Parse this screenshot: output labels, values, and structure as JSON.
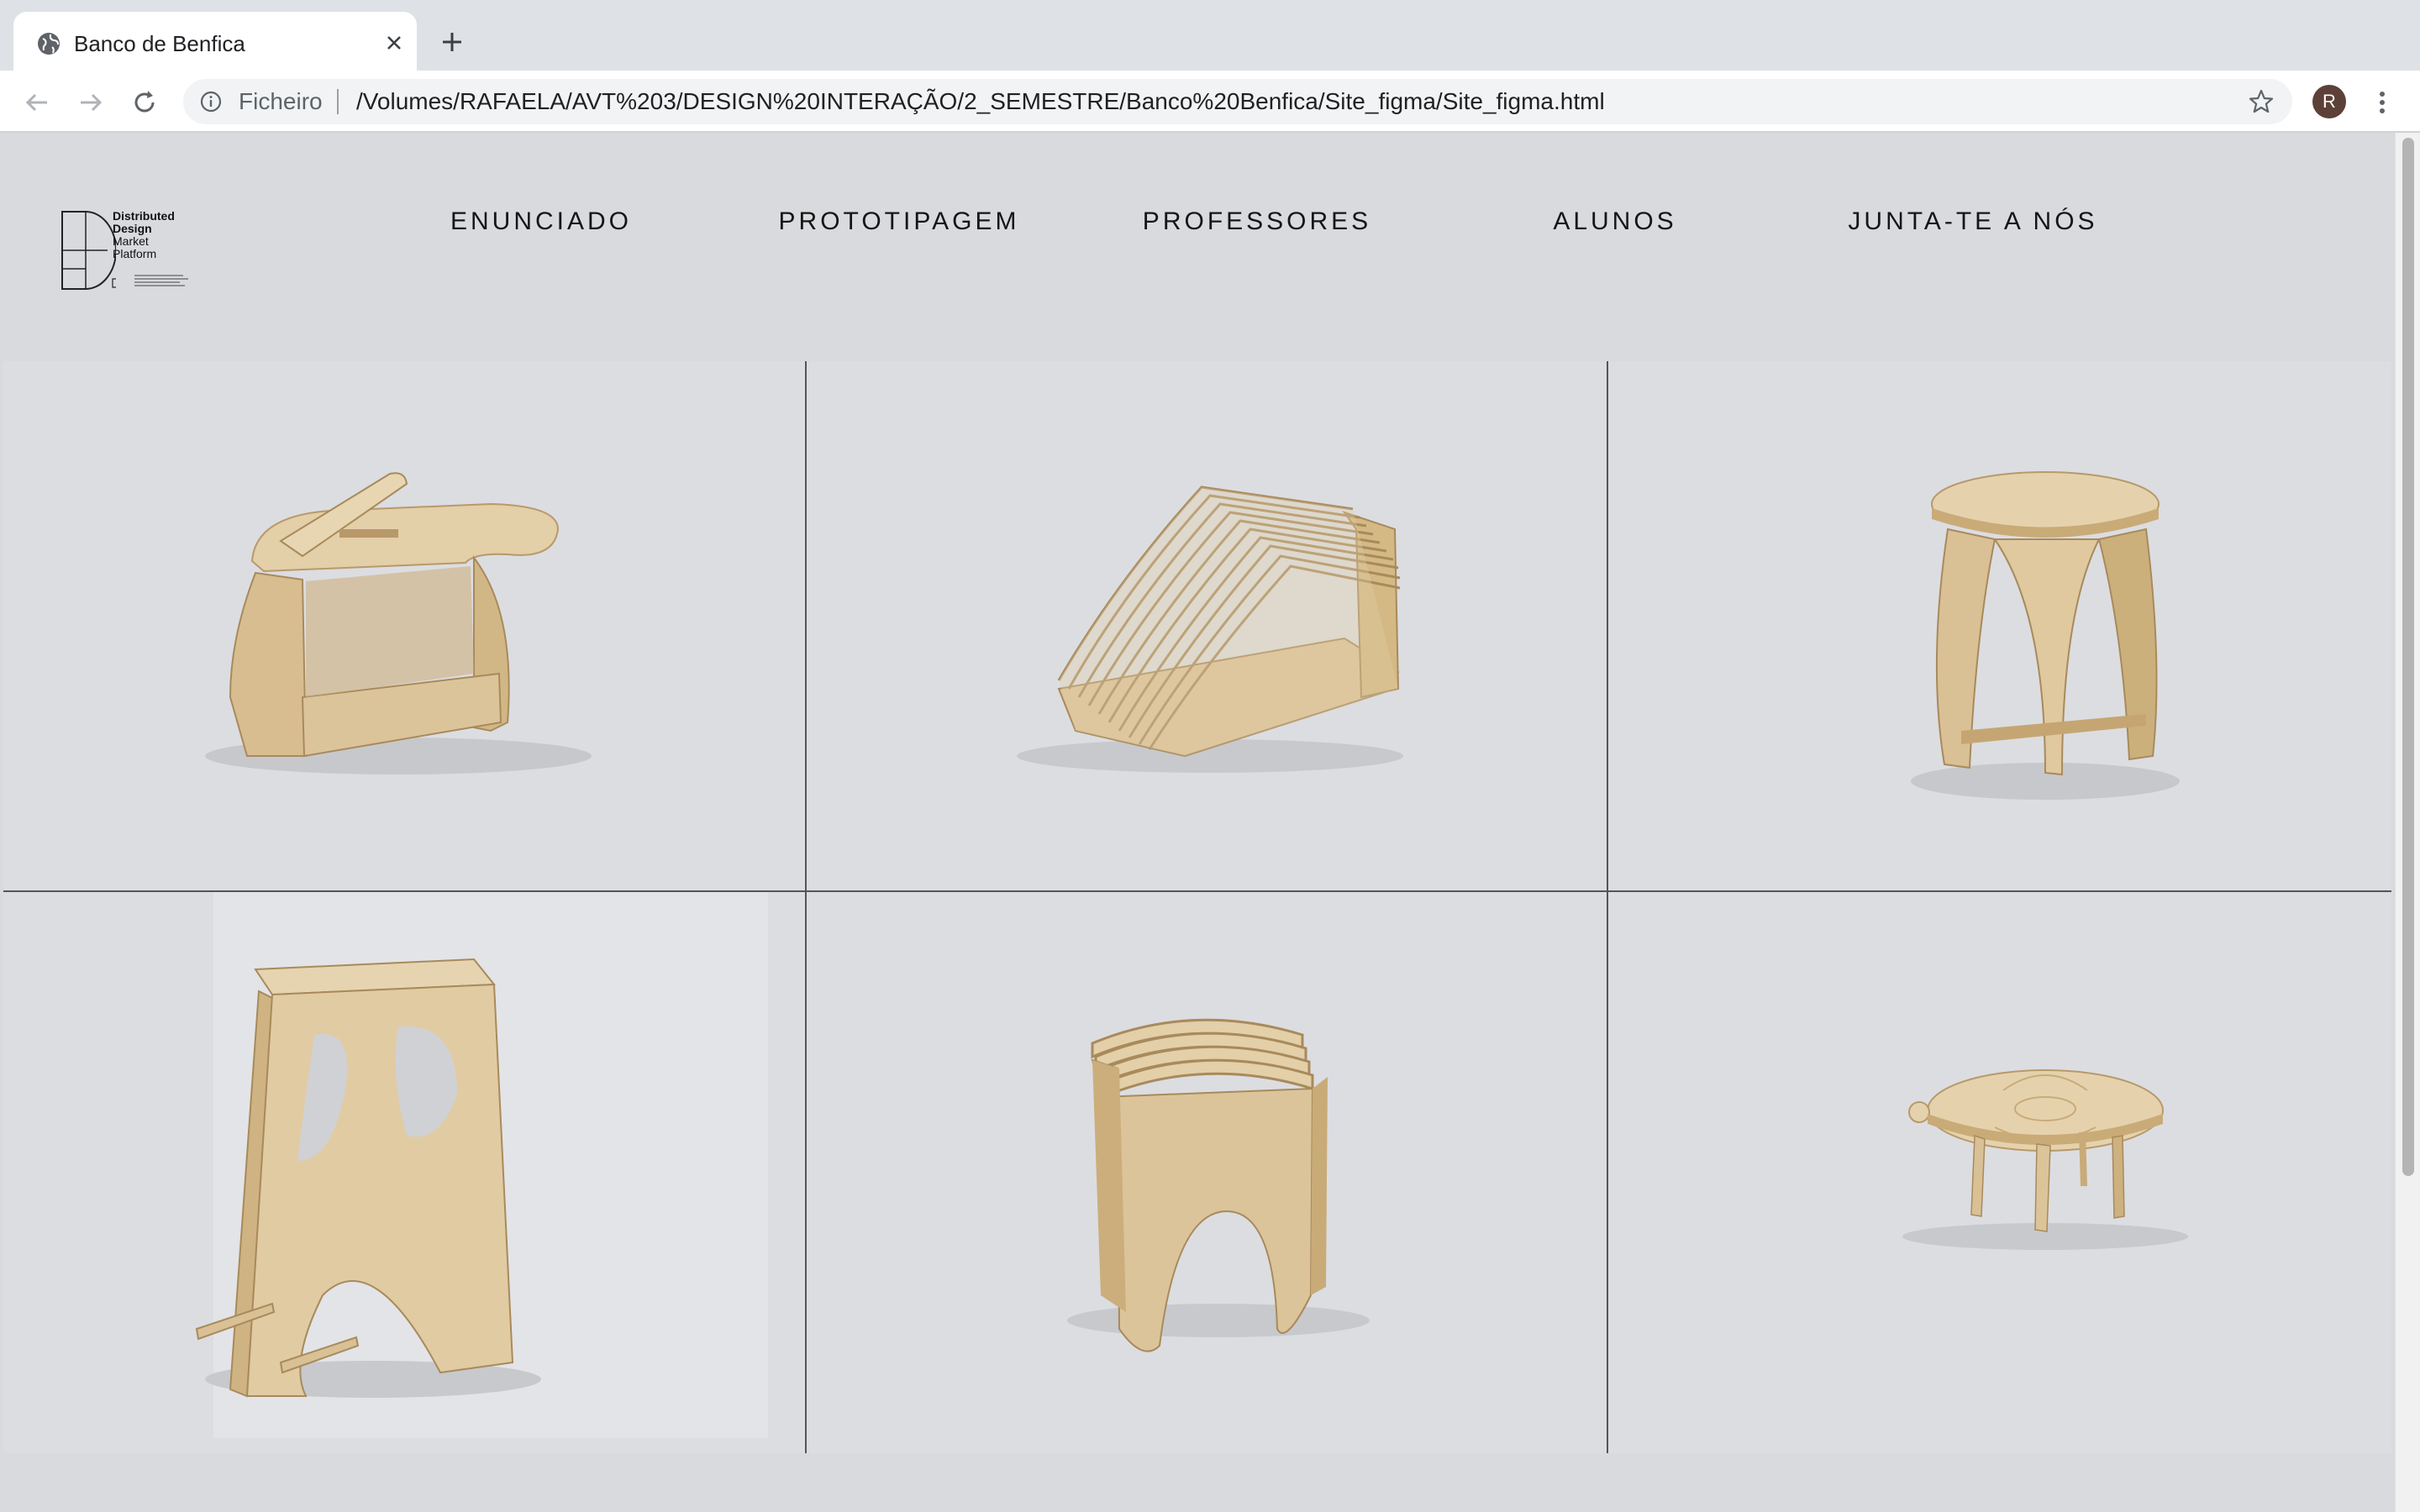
{
  "browser": {
    "tab_title": "Banco de Benfica",
    "scheme_label": "Ficheiro",
    "url": "/Volumes/RAFAELA/AVT%203/DESIGN%20INTERAÇÃO/2_SEMESTRE/Banco%20Benfica/Site_figma/Site_figma.html",
    "profile_initial": "R"
  },
  "logo": {
    "line1": "Distributed",
    "line2": "Design",
    "line3": "Market",
    "line4": "Platform"
  },
  "nav": {
    "items": [
      {
        "label": "ENUNCIADO"
      },
      {
        "label": "PROTOTIPAGEM"
      },
      {
        "label": "PROFESSORES"
      },
      {
        "label": "ALUNOS"
      },
      {
        "label": "JUNTA-TE A NÓS"
      }
    ]
  },
  "gallery": {
    "items": [
      {
        "icon": "stool-book-rest-image"
      },
      {
        "icon": "slatted-shelf-bench-image"
      },
      {
        "icon": "round-top-stool-image"
      },
      {
        "icon": "tall-stool-image"
      },
      {
        "icon": "slatted-stool-image"
      },
      {
        "icon": "low-round-table-image"
      }
    ]
  },
  "colors": {
    "page_bg": "#d9dade",
    "wood": "#d9c29a",
    "wood_dark": "#b8996a",
    "grid_line": "#555555"
  }
}
